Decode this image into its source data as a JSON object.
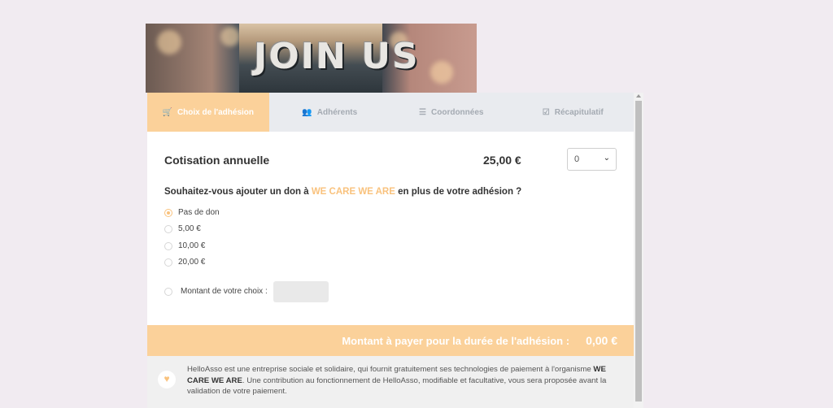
{
  "banner": {
    "text": "JOIN US"
  },
  "tabs": [
    {
      "label": "Choix de l'adhésion",
      "icon": "cart-icon",
      "glyph": "🛒",
      "active": true
    },
    {
      "label": "Adhérents",
      "icon": "users-icon",
      "glyph": "👥",
      "active": false
    },
    {
      "label": "Coordonnées",
      "icon": "list-icon",
      "glyph": "☰",
      "active": false
    },
    {
      "label": "Récapitulatif",
      "icon": "check-square-icon",
      "glyph": "☑",
      "active": false
    }
  ],
  "membership": {
    "label": "Cotisation annuelle",
    "price": "25,00 €",
    "quantity": "0"
  },
  "donation": {
    "question_prefix": "Souhaitez-vous ajouter un don à ",
    "org_name": "WE CARE WE ARE",
    "question_suffix": " en plus de votre adhésion ?",
    "options": [
      {
        "label": "Pas de don",
        "checked": true
      },
      {
        "label": "5,00 €",
        "checked": false
      },
      {
        "label": "10,00 €",
        "checked": false
      },
      {
        "label": "20,00 €",
        "checked": false
      }
    ],
    "custom_label": "Montant de votre choix :",
    "custom_value": ""
  },
  "total": {
    "label": "Montant à payer pour la durée de l'adhésion :",
    "amount": "0,00 €"
  },
  "info": {
    "text_before": "HelloAsso est une entreprise sociale et solidaire, qui fournit gratuitement ses technologies de paiement à l'organisme ",
    "org_name": "WE CARE WE ARE",
    "text_after": ". Une contribution au fonctionnement de HelloAsso, modifiable et facultative, vous sera proposée avant la validation de votre paiement."
  },
  "colors": {
    "accent": "#fbd19a",
    "org_text": "#f9c27d",
    "tab_bg": "#e9ebef"
  }
}
